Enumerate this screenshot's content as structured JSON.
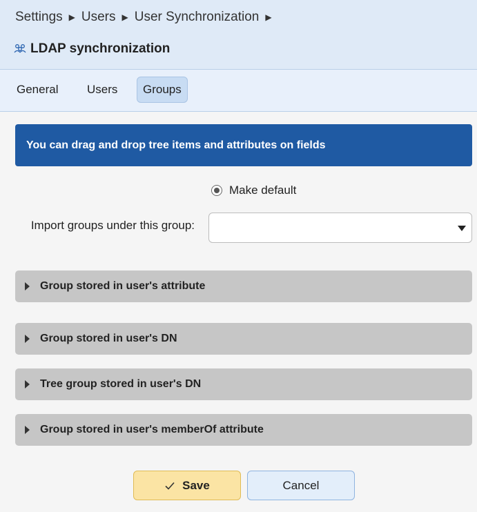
{
  "breadcrumb": [
    "Settings",
    "Users",
    "User Synchronization"
  ],
  "header": {
    "title": "LDAP synchronization",
    "icon": "users-icon"
  },
  "tabs": [
    {
      "label": "General",
      "active": false
    },
    {
      "label": "Users",
      "active": false
    },
    {
      "label": "Groups",
      "active": true
    }
  ],
  "info_banner": "You can drag and drop tree items and attributes on fields",
  "make_default": {
    "label": "Make default"
  },
  "import_groups": {
    "label": "Import groups under this group:",
    "value": ""
  },
  "sections": [
    {
      "label": "Group stored in user's attribute"
    },
    {
      "label": "Group stored in user's DN"
    },
    {
      "label": "Tree group stored in user's DN"
    },
    {
      "label": "Group stored in user's memberOf attribute"
    }
  ],
  "buttons": {
    "save": "Save",
    "cancel": "Cancel"
  },
  "colors": {
    "banner": "#1f5aa3",
    "header_bg": "#dfeaf7",
    "save_bg": "#fbe4a4",
    "section_bg": "#c6c6c6"
  }
}
